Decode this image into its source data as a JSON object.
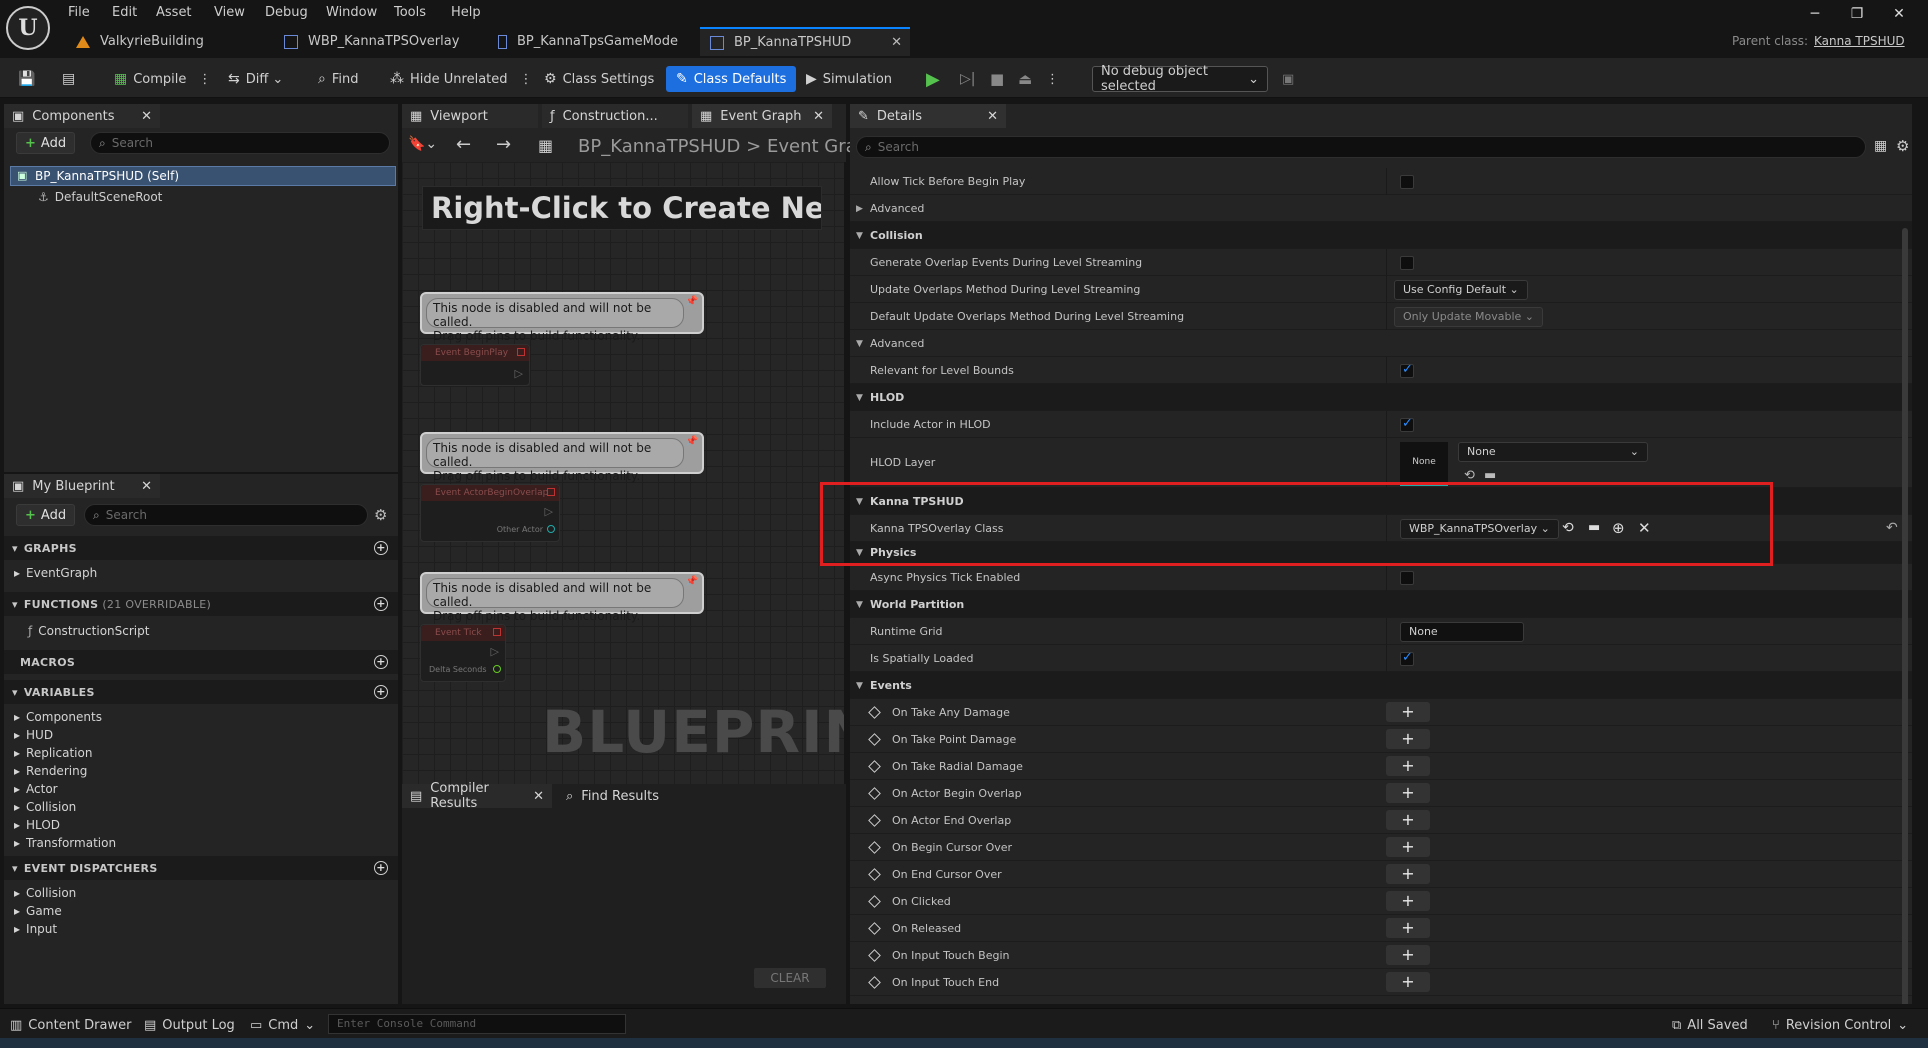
{
  "menu": [
    "File",
    "Edit",
    "Asset",
    "View",
    "Debug",
    "Window",
    "Tools",
    "Help"
  ],
  "tabs": [
    {
      "label": "ValkyrieBuilding"
    },
    {
      "label": "WBP_KannaTPSOverlay"
    },
    {
      "label": "BP_KannaTpsGameMode"
    },
    {
      "label": "BP_KannaTPSHUD"
    }
  ],
  "parent_class_label": "Parent class:",
  "parent_class_value": "Kanna TPSHUD",
  "toolbar": {
    "compile": "Compile",
    "diff": "Diff",
    "find": "Find",
    "hide_unrelated": "Hide Unrelated",
    "class_settings": "Class Settings",
    "class_defaults": "Class Defaults",
    "simulation": "Simulation",
    "debug_object": "No debug object selected"
  },
  "components": {
    "tab": "Components",
    "add": "Add",
    "search_placeholder": "Search",
    "items": [
      "BP_KannaTPSHUD (Self)",
      "DefaultSceneRoot"
    ]
  },
  "my_blueprint": {
    "tab": "My Blueprint",
    "add": "Add",
    "search_placeholder": "Search",
    "graphs": "GRAPHS",
    "graph_items": [
      "EventGraph"
    ],
    "functions": "FUNCTIONS",
    "functions_sub": "(21 OVERRIDABLE)",
    "function_items": [
      "ConstructionScript"
    ],
    "macros": "MACROS",
    "variables": "VARIABLES",
    "variable_items": [
      "Components",
      "HUD",
      "Replication",
      "Rendering",
      "Actor",
      "Collision",
      "HLOD",
      "Transformation"
    ],
    "dispatchers": "EVENT DISPATCHERS",
    "dispatcher_items": [
      "Collision",
      "Game",
      "Input"
    ]
  },
  "graph": {
    "tabs": [
      "Viewport",
      "Construction...",
      "Event Graph"
    ],
    "breadcrumb_root": "BP_KannaTPSHUD",
    "breadcrumb_sep": ">",
    "breadcrumb_leaf": "Event Gra",
    "hint": "Right-Click to Create New Nod",
    "disabled_line1": "This node is disabled and will not be called.",
    "disabled_line2": "Drag off pins to build functionality.",
    "node1": "Event BeginPlay",
    "node2": "Event ActorBeginOverlap",
    "node2_pin": "Other Actor",
    "node3": "Event Tick",
    "node3_pin": "Delta Seconds",
    "watermark": "BLUEPRINT"
  },
  "results": {
    "compiler": "Compiler Results",
    "find": "Find Results",
    "clear": "CLEAR"
  },
  "details": {
    "tab": "Details",
    "search_placeholder": "Search",
    "rows": {
      "allow_tick": "Allow Tick Before Begin Play",
      "advanced1": "Advanced",
      "collision": "Collision",
      "gen_overlap": "Generate Overlap Events During Level Streaming",
      "update_overlaps": "Update Overlaps Method During Level Streaming",
      "update_overlaps_value": "Use Config Default",
      "default_update": "Default Update Overlaps Method During Level Streaming",
      "default_update_value": "Only Update Movable",
      "advanced2": "Advanced",
      "relevant_bounds": "Relevant for Level Bounds",
      "hlod": "HLOD",
      "include_hlod": "Include Actor in HLOD",
      "hlod_layer": "HLOD Layer",
      "hlod_layer_thumb": "None",
      "hlod_layer_value": "None",
      "kanna_cat": "Kanna TPSHUD",
      "kanna_overlay": "Kanna TPSOverlay Class",
      "kanna_overlay_value": "WBP_KannaTPSOverlay",
      "physics": "Physics",
      "async_physics": "Async Physics Tick Enabled",
      "world_partition": "World Partition",
      "runtime_grid": "Runtime Grid",
      "runtime_grid_value": "None",
      "spatially_loaded": "Is Spatially Loaded",
      "events": "Events"
    },
    "events": [
      "On Take Any Damage",
      "On Take Point Damage",
      "On Take Radial Damage",
      "On Actor Begin Overlap",
      "On Actor End Overlap",
      "On Begin Cursor Over",
      "On End Cursor Over",
      "On Clicked",
      "On Released",
      "On Input Touch Begin",
      "On Input Touch End"
    ]
  },
  "bottom": {
    "content_drawer": "Content Drawer",
    "output_log": "Output Log",
    "cmd": "Cmd",
    "console_placeholder": "Enter Console Command",
    "all_saved": "All Saved",
    "revision_control": "Revision Control"
  },
  "colors": {
    "accent": "#1d6fe0",
    "highlight": "#e02020",
    "play": "#55c24e"
  }
}
